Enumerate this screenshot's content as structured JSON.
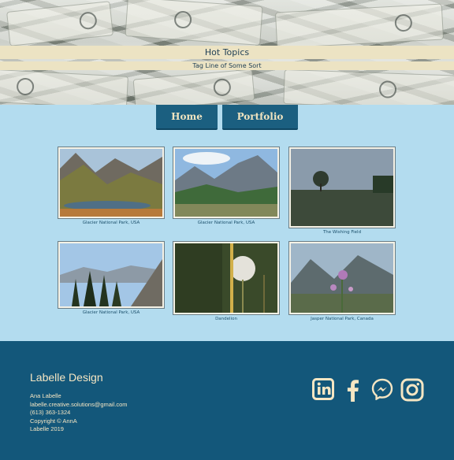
{
  "header": {
    "title": "Hot Topics",
    "tagline": "Tag Line of Some Sort"
  },
  "nav": {
    "items": [
      {
        "label": "Home"
      },
      {
        "label": "Portfolio"
      }
    ]
  },
  "gallery": {
    "items": [
      {
        "caption": "Glacier National Park, USA"
      },
      {
        "caption": "Glacier National Park, USA"
      },
      {
        "caption": "The Wishing Field"
      },
      {
        "caption": "Glacier National Park, USA"
      },
      {
        "caption": "Dandelion"
      },
      {
        "caption": "Jasper National Park, Canada"
      }
    ]
  },
  "footer": {
    "brand": "Labelle Design",
    "name": "Ana Labelle",
    "email": "labelle.creative.solutions@gmail.com",
    "phone": "(613) 363-1324",
    "copyright": "Copyright © AnnA",
    "year_line": "Labelle 2019",
    "social": [
      "linkedin-icon",
      "facebook-icon",
      "messenger-icon",
      "instagram-icon"
    ],
    "icon_color": "#f5e6c3"
  },
  "colors": {
    "page_bg": "#b3dcef",
    "accent": "#1b5f80",
    "footer_bg": "#13577a",
    "band_bg": "#ece3c3"
  }
}
